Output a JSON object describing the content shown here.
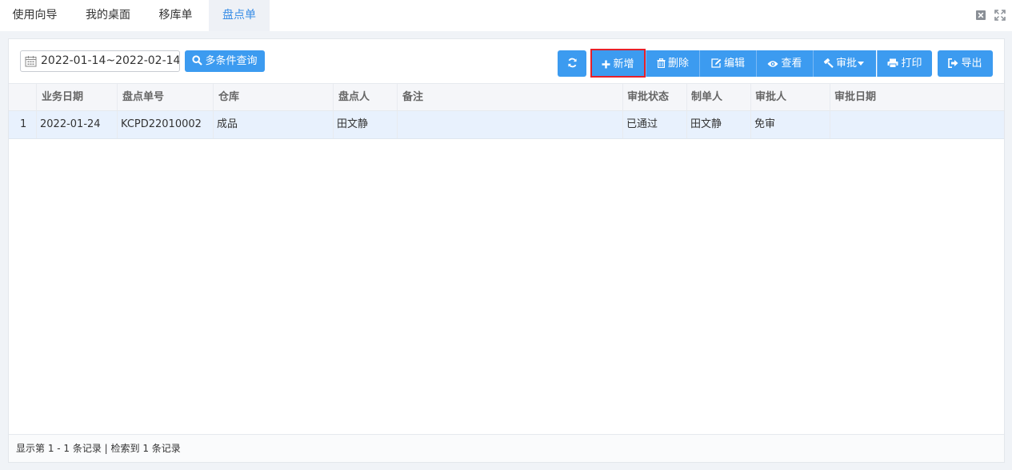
{
  "tabs": [
    {
      "label": "使用向导"
    },
    {
      "label": "我的桌面"
    },
    {
      "label": "移库单"
    },
    {
      "label": "盘点单"
    }
  ],
  "toolbar": {
    "date_range": "2022-01-14~2022-02-14",
    "search_label": "多条件查询",
    "add_label": "新增",
    "delete_label": "删除",
    "edit_label": "编辑",
    "view_label": "查看",
    "approve_label": "审批",
    "print_label": "打印",
    "export_label": "导出"
  },
  "grid": {
    "columns": [
      "业务日期",
      "盘点单号",
      "仓库",
      "盘点人",
      "备注",
      "审批状态",
      "制单人",
      "审批人",
      "审批日期"
    ],
    "rows": [
      {
        "index": "1",
        "date": "2022-01-24",
        "number": "KCPD22010002",
        "warehouse": "成品",
        "counter": "田文静",
        "remark": "",
        "status": "已通过",
        "creator": "田文静",
        "approver": "免审",
        "approve_date": ""
      }
    ]
  },
  "footer": {
    "text": "显示第 1 - 1 条记录 | 检索到 1 条记录"
  },
  "colors": {
    "accent": "#3c9bf0",
    "highlight_border": "#e6202a",
    "active_tab_text": "#3a8ee6"
  }
}
